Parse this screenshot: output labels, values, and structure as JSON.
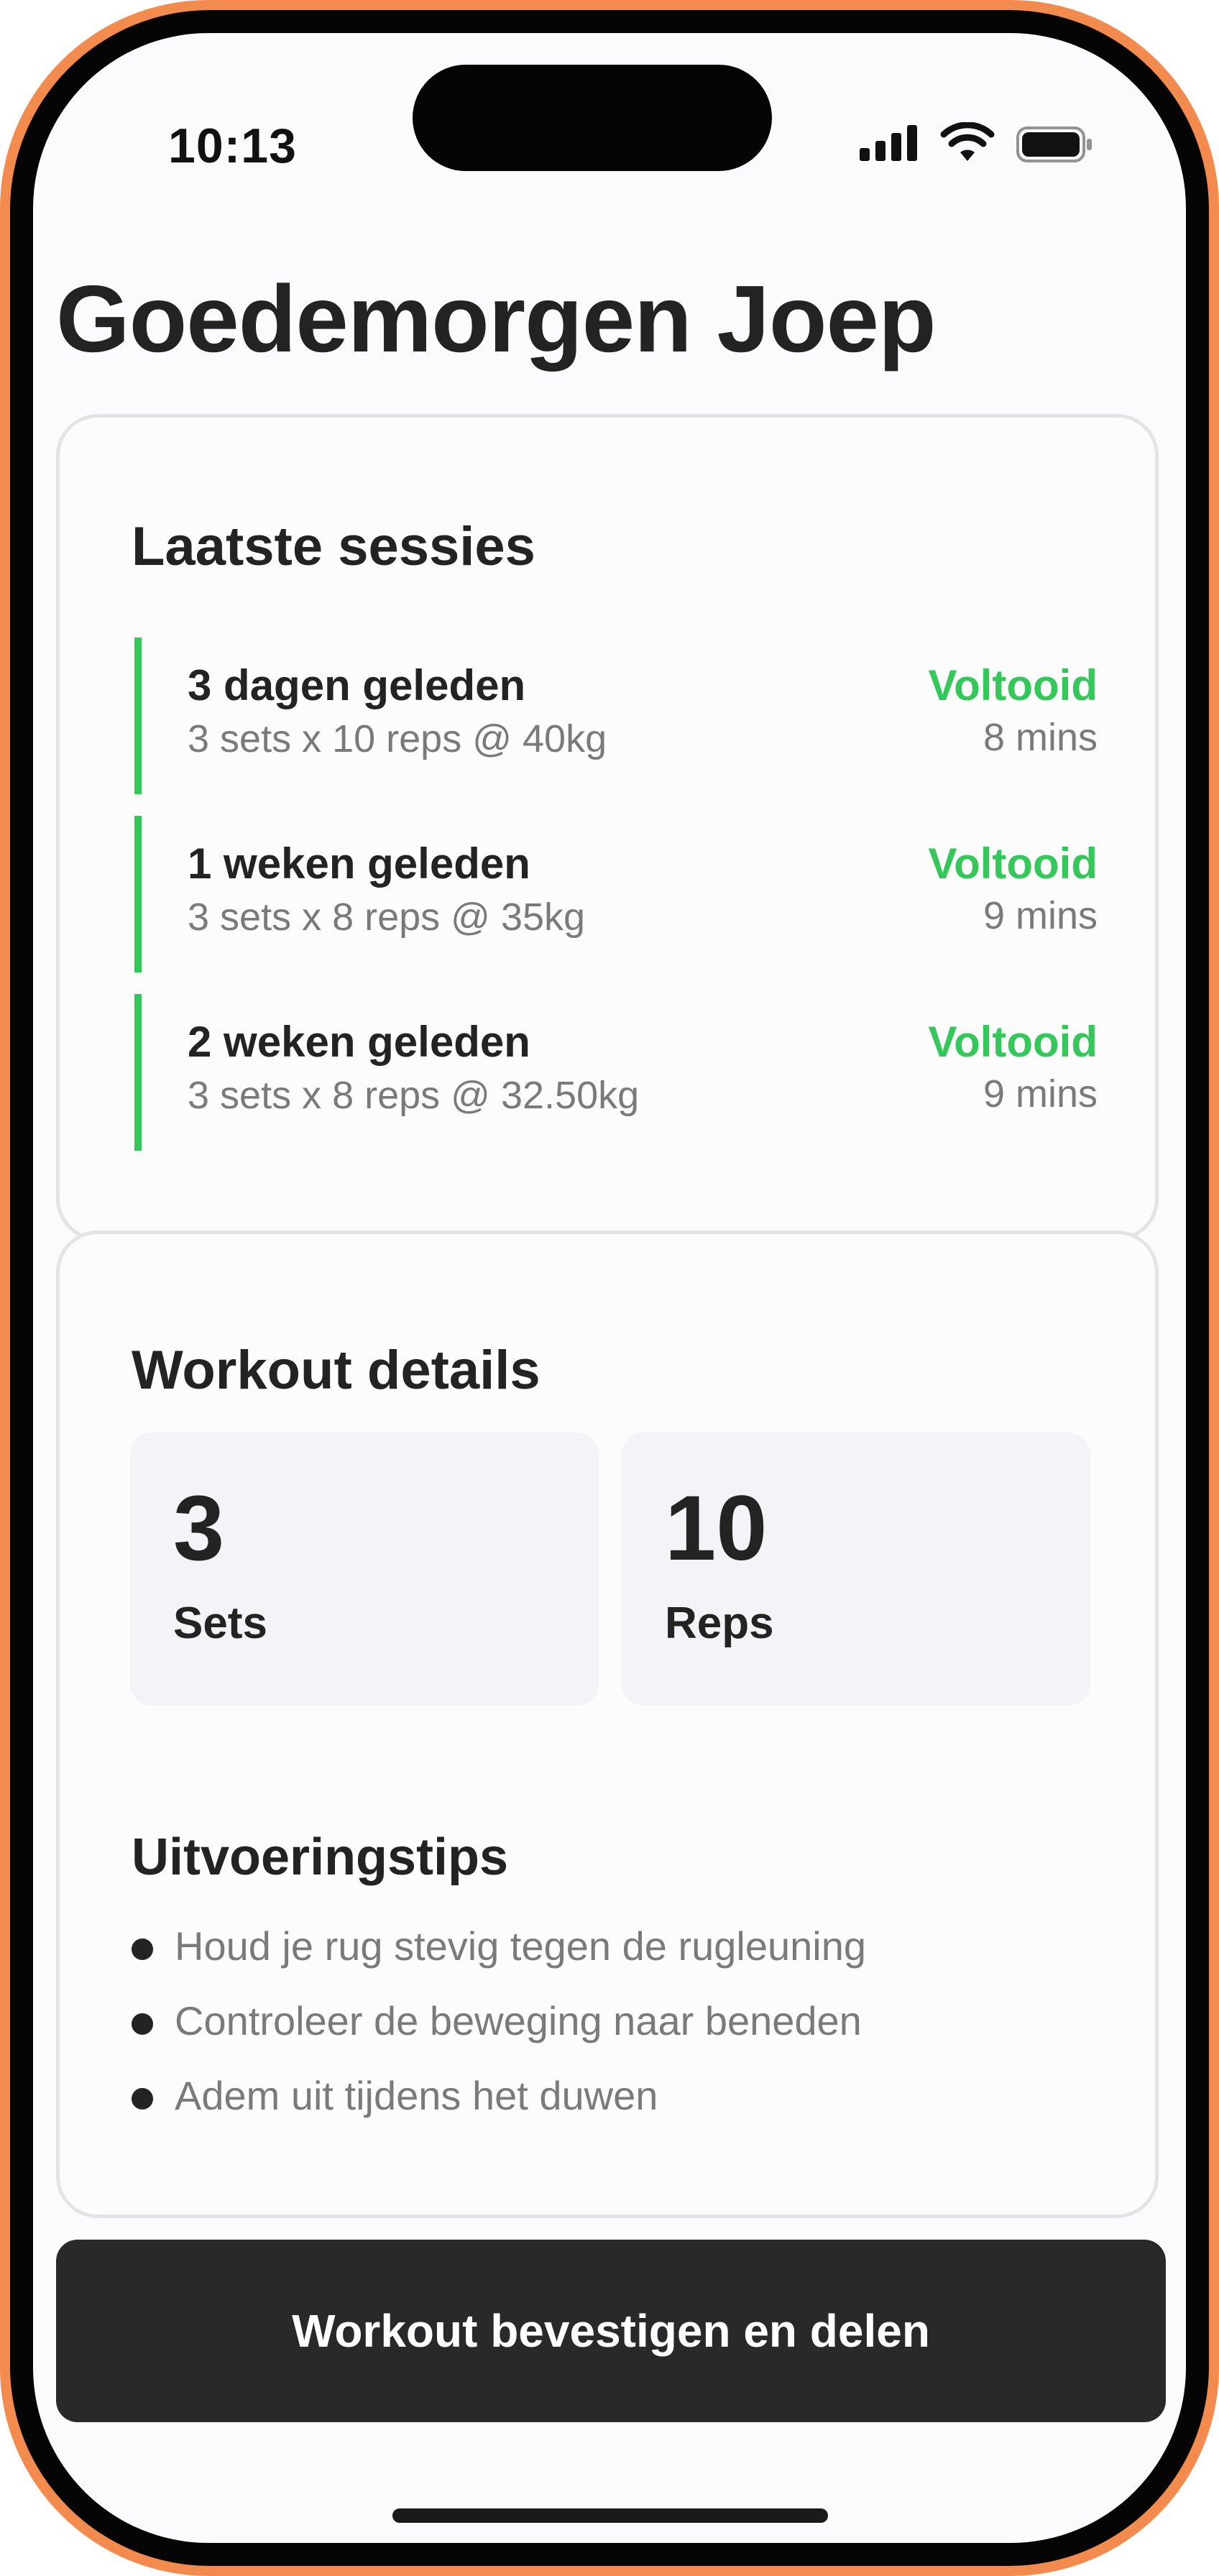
{
  "status_bar": {
    "time": "10:13",
    "icons": [
      "signal-icon",
      "wifi-icon",
      "battery-icon"
    ]
  },
  "header": {
    "greeting": "Goedemorgen Joep"
  },
  "sessions": {
    "title": "Laatste sessies",
    "items": [
      {
        "when": "3 dagen geleden",
        "detail": "3 sets x 10 reps @ 40kg",
        "status": "Voltooid",
        "duration": "8 mins"
      },
      {
        "when": "1 weken geleden",
        "detail": "3 sets x 8 reps @ 35kg",
        "status": "Voltooid",
        "duration": "9 mins"
      },
      {
        "when": "2 weken geleden",
        "detail": "3 sets x 8 reps @ 32.50kg",
        "status": "Voltooid",
        "duration": "9 mins"
      }
    ]
  },
  "workout": {
    "title": "Workout details",
    "stats": [
      {
        "value": "3",
        "label": "Sets"
      },
      {
        "value": "10",
        "label": "Reps"
      }
    ],
    "tips_title": "Uitvoeringstips",
    "tips": [
      "Houd je rug stevig tegen de rugleuning",
      "Controleer de beweging naar beneden",
      "Adem uit tijdens het duwen"
    ]
  },
  "actions": {
    "confirm_label": "Workout bevestigen en delen"
  },
  "colors": {
    "frame": "#F38A4E",
    "accent_green": "#34C759",
    "button_bg": "#29292B"
  }
}
